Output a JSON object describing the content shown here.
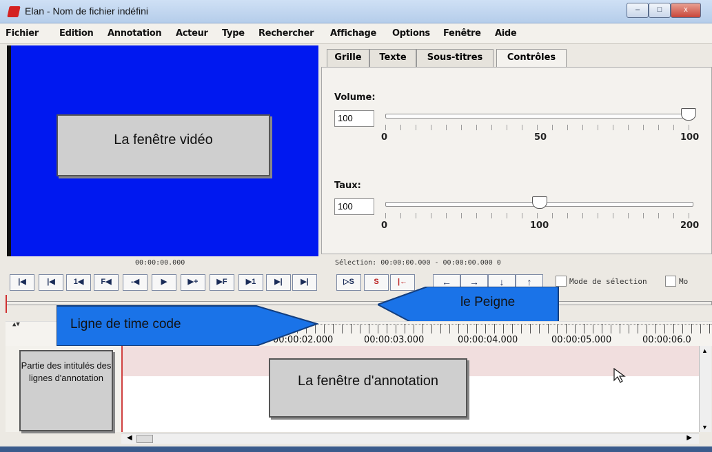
{
  "window": {
    "title": "Elan - Nom de fichier indéfini"
  },
  "menu": [
    "Fichier",
    "Edition",
    "Annotation",
    "Acteur",
    "Type",
    "Rechercher",
    "Affichage",
    "Options",
    "Fenêtre",
    "Aide"
  ],
  "video": {
    "callout": "La fenêtre vidéo",
    "timecode": "00:00:00.000"
  },
  "tabs": [
    "Grille",
    "Texte",
    "Sous-titres",
    "Contrôles"
  ],
  "controls": {
    "volume": {
      "label": "Volume:",
      "value": "100",
      "ticks": [
        "0",
        "50",
        "100"
      ],
      "level_fraction": 1.0
    },
    "rate": {
      "label": "Taux:",
      "value": "100",
      "ticks": [
        "0",
        "100",
        "200"
      ],
      "level_fraction": 0.5
    }
  },
  "selection_text": "Sélection: 00:00:00.000 - 00:00:00.000  0",
  "player_buttons": [
    "|◀",
    "|◀",
    "1◀",
    "F◀",
    "-◀",
    "▶",
    "▶+",
    "▶F",
    "▶1",
    "▶|",
    "▶|"
  ],
  "selection_buttons": [
    "▷S",
    "S",
    "|←"
  ],
  "nav_buttons": [
    "←",
    "→",
    "↓",
    "↑"
  ],
  "mode_selection": "Mode de sélection",
  "mode_other": "Mo",
  "comb_callout": "le Peigne",
  "timecode_callout": "Ligne de time code",
  "ruler_labels": [
    "00:00:02.000",
    "00:00:03.000",
    "00:00:04.000",
    "00:00:05.000",
    "00:00:06.0"
  ],
  "annotation_callout": "La fenêtre d'annotation",
  "tier_callout": "Partie des intitulés des lignes d'annotation"
}
